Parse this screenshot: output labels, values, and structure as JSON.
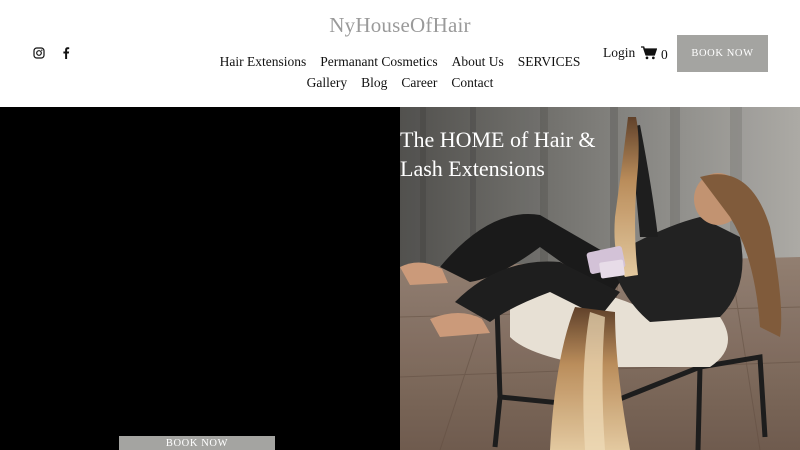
{
  "header": {
    "logo": "NyHouseOfHair",
    "nav_row1": [
      "Hair Extensions",
      "Permanant Cosmetics",
      "About Us",
      "SERVICES"
    ],
    "nav_row2": [
      "Gallery",
      "Blog",
      "Career",
      "Contact"
    ],
    "login_label": "Login",
    "cart_count": "0",
    "book_now_label": "BOOK NOW",
    "social_icons": [
      "instagram-icon",
      "facebook-icon"
    ]
  },
  "hero": {
    "headline_line1": "The HOME of Hair &",
    "headline_line2": "Lash Extensions",
    "book_now_label": "BOOK NOW",
    "image_subject": "woman with long blonde hair extensions reclining in a chair"
  },
  "colors": {
    "logo": "#9a9a9a",
    "button_bg": "#a4a4a1",
    "hero_left_bg": "#000000",
    "text": "#111111"
  }
}
